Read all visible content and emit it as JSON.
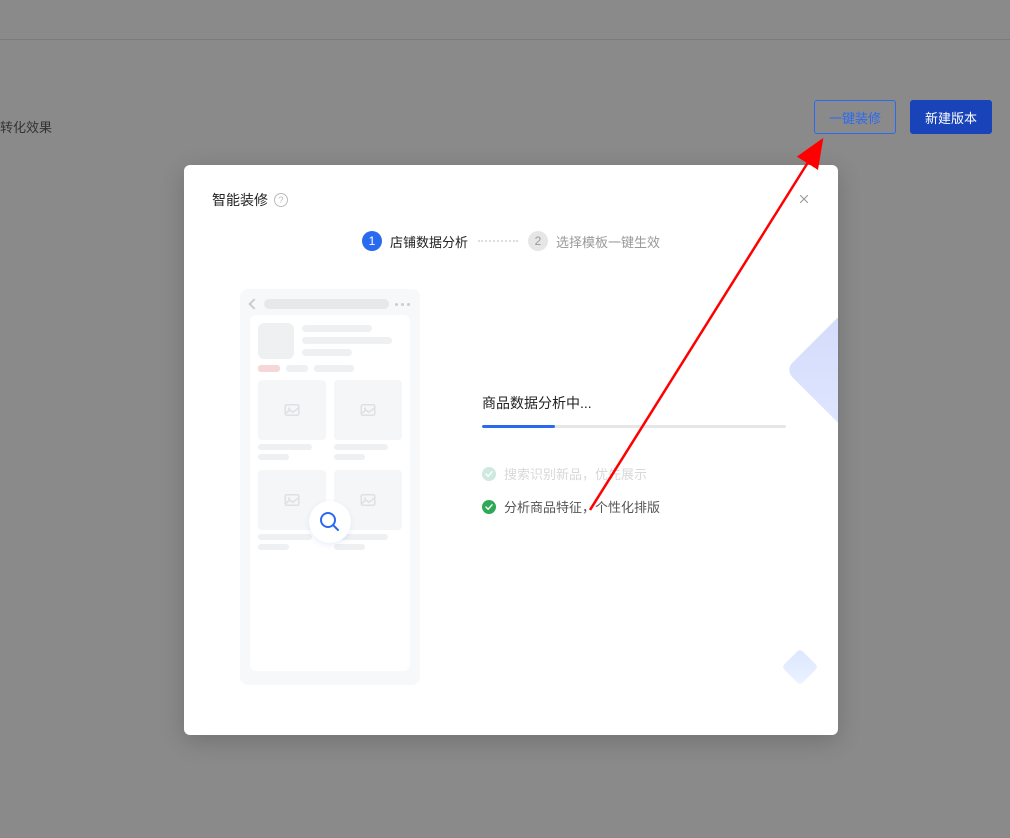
{
  "background": {
    "page_label": "转化效果",
    "buttons": {
      "decorate": "一键装修",
      "new_version": "新建版本"
    }
  },
  "modal": {
    "title": "智能装修",
    "steps": {
      "step1": {
        "num": "1",
        "label": "店铺数据分析"
      },
      "step2": {
        "num": "2",
        "label": "选择模板一键生效"
      }
    },
    "analysis": {
      "title": "商品数据分析中...",
      "progress_pct": 24,
      "item_faded": "搜索识别新品，优先展示",
      "item_done": "分析商品特征，个性化排版"
    }
  }
}
